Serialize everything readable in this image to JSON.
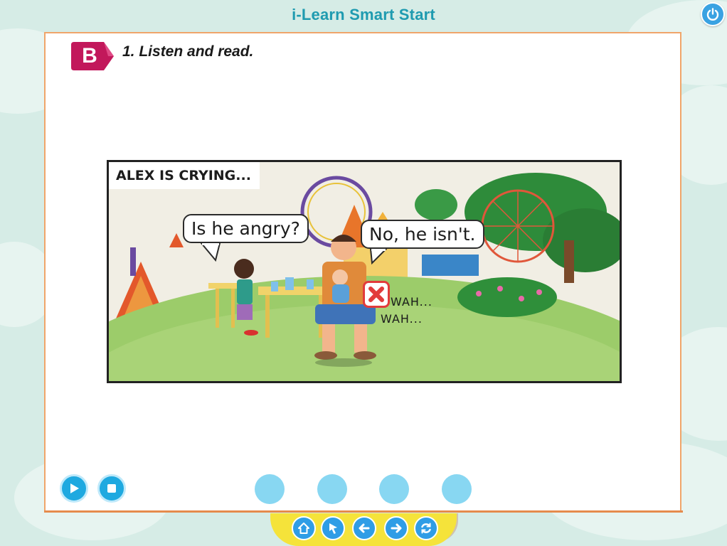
{
  "app": {
    "title": "i-Learn Smart Start"
  },
  "activity": {
    "section_letter": "B",
    "instruction": "1. Listen and read."
  },
  "comic": {
    "caption": "ALEX IS CRYING...",
    "bubble_left": "Is he angry?",
    "bubble_right": "No, he isn't.",
    "sound_line1": "WAH...",
    "sound_line2": "WAH..."
  },
  "icons": {
    "power": "power-icon",
    "play": "play-icon",
    "stop": "stop-icon",
    "home": "home-icon",
    "pointer": "cursor-icon",
    "back": "arrow-left-icon",
    "next": "arrow-right-icon",
    "reset": "refresh-icon",
    "wrong": "cross-icon"
  },
  "colors": {
    "accent": "#1f9bb0",
    "badge": "#c2185b",
    "panel_border": "#f0a56a",
    "nav_tray": "#f5e33a",
    "button_blue": "#2f9de6"
  }
}
